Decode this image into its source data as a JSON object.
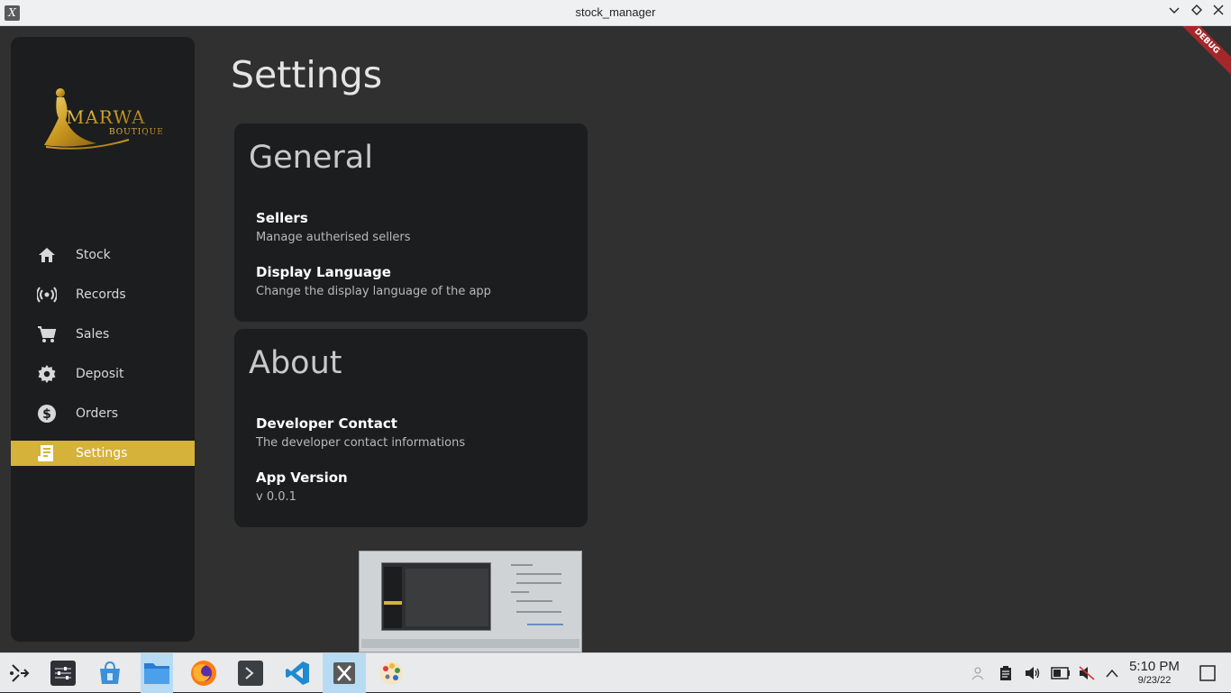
{
  "window": {
    "title": "stock_manager",
    "app_icon_glyph": "X"
  },
  "debug_banner": "DEBUG",
  "brand": {
    "name": "MARWA",
    "tagline": "BOUTIQUE"
  },
  "sidebar": {
    "items": [
      {
        "label": "Stock",
        "icon": "home-icon",
        "active": false
      },
      {
        "label": "Records",
        "icon": "broadcast-icon",
        "active": false
      },
      {
        "label": "Sales",
        "icon": "shopping-cart-icon",
        "active": false
      },
      {
        "label": "Deposit",
        "icon": "gear-icon",
        "active": false
      },
      {
        "label": "Orders",
        "icon": "dollar-icon",
        "active": false
      },
      {
        "label": "Settings",
        "icon": "receipt-icon",
        "active": true
      }
    ]
  },
  "page": {
    "title": "Settings"
  },
  "general": {
    "heading": "General",
    "items": [
      {
        "title": "Sellers",
        "subtitle": "Manage autherised sellers"
      },
      {
        "title": "Display Language",
        "subtitle": "Change the display language of the app"
      }
    ]
  },
  "about": {
    "heading": "About",
    "items": [
      {
        "title": "Developer Contact",
        "subtitle": "The developer contact informations"
      },
      {
        "title": "App Version",
        "subtitle": "v 0.0.1"
      }
    ]
  },
  "taskbar": {
    "apps": [
      "launcher-icon",
      "settings-icon",
      "store-icon",
      "files-icon",
      "firefox-icon",
      "terminal-icon",
      "vscode-icon",
      "stock-manager-icon",
      "paint-icon"
    ],
    "active_app": "stock-manager-icon",
    "clock": {
      "time": "5:10 PM",
      "date": "9/23/22"
    }
  },
  "colors": {
    "accent": "#d5b239",
    "sidebar_bg": "#1b1d1e",
    "app_bg": "#303030",
    "card_bg": "#1b1d1e",
    "debug": "#a3282a"
  }
}
